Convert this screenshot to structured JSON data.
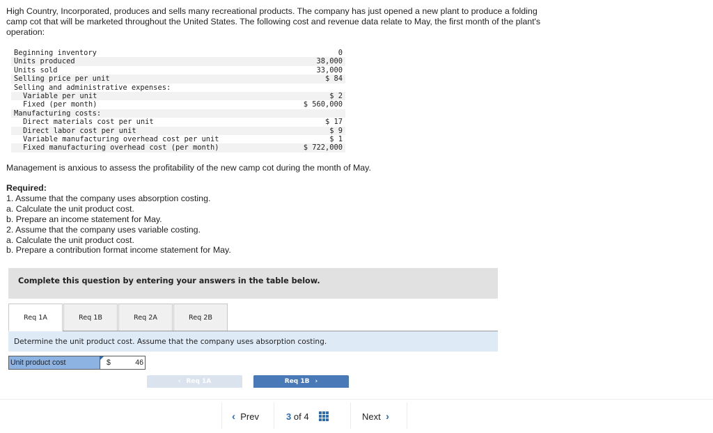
{
  "intro": "High Country, Incorporated, produces and sells many recreational products. The company has just opened a new plant to produce a folding camp cot that will be marketed throughout the United States. The following cost and revenue data relate to May, the first month of the plant's operation:",
  "data_rows": [
    {
      "label": "Beginning inventory",
      "value": "0",
      "indent": false
    },
    {
      "label": "Units produced",
      "value": "38,000",
      "indent": false
    },
    {
      "label": "Units sold",
      "value": "33,000",
      "indent": false
    },
    {
      "label": "Selling price per unit",
      "value": "$ 84",
      "indent": false
    },
    {
      "label": "Selling and administrative expenses:",
      "value": "",
      "indent": false
    },
    {
      "label": "Variable per unit",
      "value": "$ 2",
      "indent": true
    },
    {
      "label": "Fixed (per month)",
      "value": "$ 560,000",
      "indent": true
    },
    {
      "label": "Manufacturing costs:",
      "value": "",
      "indent": false
    },
    {
      "label": "Direct materials cost per unit",
      "value": "$ 17",
      "indent": true
    },
    {
      "label": "Direct labor cost per unit",
      "value": "$ 9",
      "indent": true
    },
    {
      "label": "Variable manufacturing overhead cost per unit",
      "value": "$ 1",
      "indent": true
    },
    {
      "label": "Fixed manufacturing overhead cost (per month)",
      "value": "$ 722,000",
      "indent": true
    }
  ],
  "management_note": "Management is anxious to assess the profitability of the new camp cot during the month of May.",
  "required": {
    "title": "Required:",
    "items": [
      "1. Assume that the company uses absorption costing.",
      "a. Calculate the unit product cost.",
      "b. Prepare an income statement for May.",
      "2. Assume that the company uses variable costing.",
      "a. Calculate the unit product cost.",
      "b. Prepare a contribution format income statement for May."
    ]
  },
  "banner": "Complete this question by entering your answers in the table below.",
  "tabs": [
    {
      "label": "Req 1A",
      "active": true
    },
    {
      "label": "Req 1B",
      "active": false
    },
    {
      "label": "Req 2A",
      "active": false
    },
    {
      "label": "Req 2B",
      "active": false
    }
  ],
  "instruction": "Determine the unit product cost. Assume that the company uses absorption costing.",
  "answer": {
    "label": "Unit product cost",
    "currency": "$",
    "value": "46"
  },
  "nav_buttons": {
    "prev": "Req 1A",
    "next": "Req 1B",
    "prev_chevron": "‹",
    "next_chevron": "›"
  },
  "footer": {
    "prev": "Prev",
    "current_page": "3",
    "of": "of",
    "total_pages": "4",
    "next": "Next",
    "left_chevron": "‹",
    "right_chevron": "›"
  },
  "colors": {
    "accent": "#2e6db4",
    "tab_line": "#9a9a9a",
    "answer_label_bg": "#8db3e2",
    "next_btn": "#4a79b7",
    "prev_btn": "#dae3ee",
    "instruction_bg": "#deebf7",
    "banner_bg": "#e1e1e1"
  }
}
